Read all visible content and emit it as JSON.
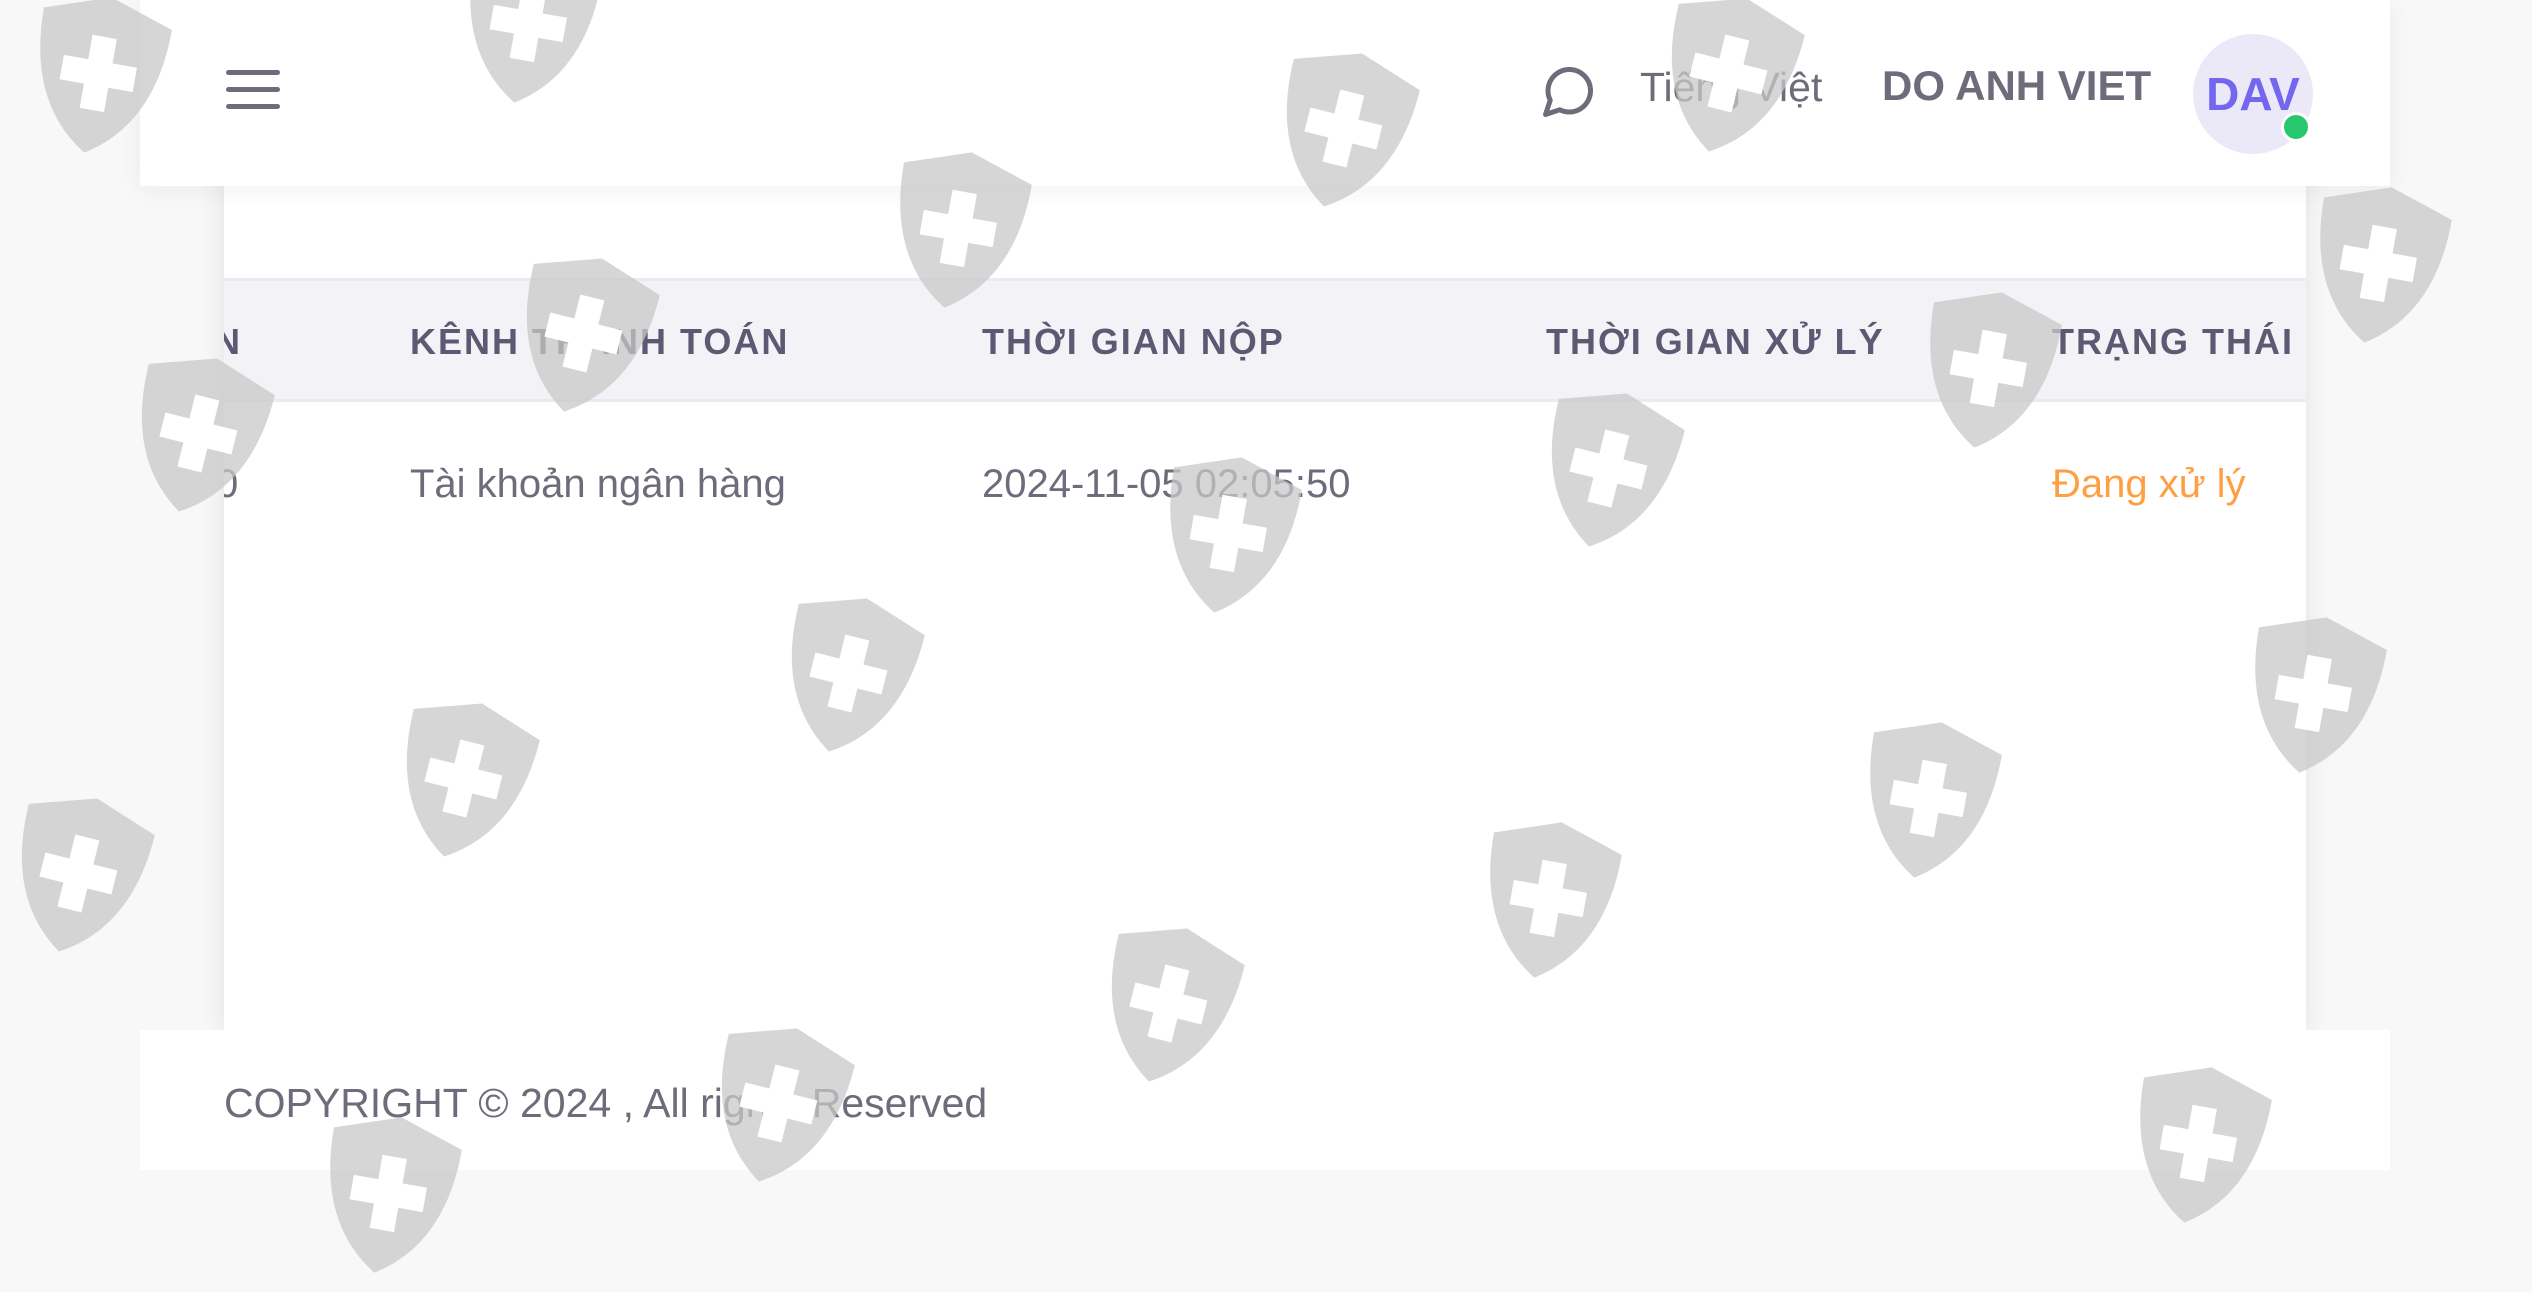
{
  "navbar": {
    "menu_icon": "hamburger-menu-icon",
    "chat_icon": "chat-bubble-icon",
    "language": "Tiếng Việt",
    "user_name": "DO ANH VIET",
    "avatar_initials": "DAV",
    "online_status_color": "#28c76f"
  },
  "table": {
    "columns": [
      "N",
      "KÊNH THANH TOÁN",
      "THỜI GIAN NỘP",
      "THỜI GIAN XỬ LÝ",
      "TRẠNG THÁI"
    ],
    "rows": [
      {
        "amount": "0",
        "channel": "Tài khoản ngân hàng",
        "submitted_at": "2024-11-05 02:05:50",
        "processed_at": "",
        "status": "Đang xử lý"
      }
    ]
  },
  "footer": {
    "copyright": "COPYRIGHT © 2024 , All rights Reserved"
  },
  "colors": {
    "primary": "#7367f0",
    "status_pending": "#ff9f43",
    "watermark": "#c8c8c8"
  }
}
